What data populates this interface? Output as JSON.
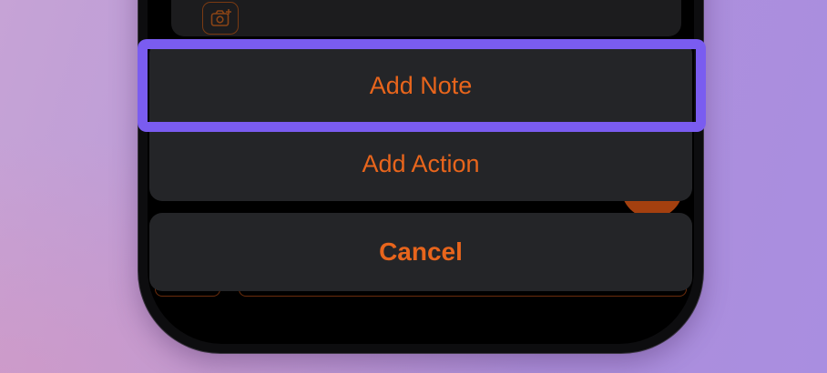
{
  "action_sheet": {
    "buttons": [
      {
        "label": "Add Note"
      },
      {
        "label": "Add Action"
      }
    ],
    "cancel_label": "Cancel"
  },
  "colors": {
    "accent": "#e8651c",
    "highlight": "#7a5cf0",
    "sheet_background": "#242528"
  },
  "icons": {
    "background_icon": "camera-add-icon"
  }
}
